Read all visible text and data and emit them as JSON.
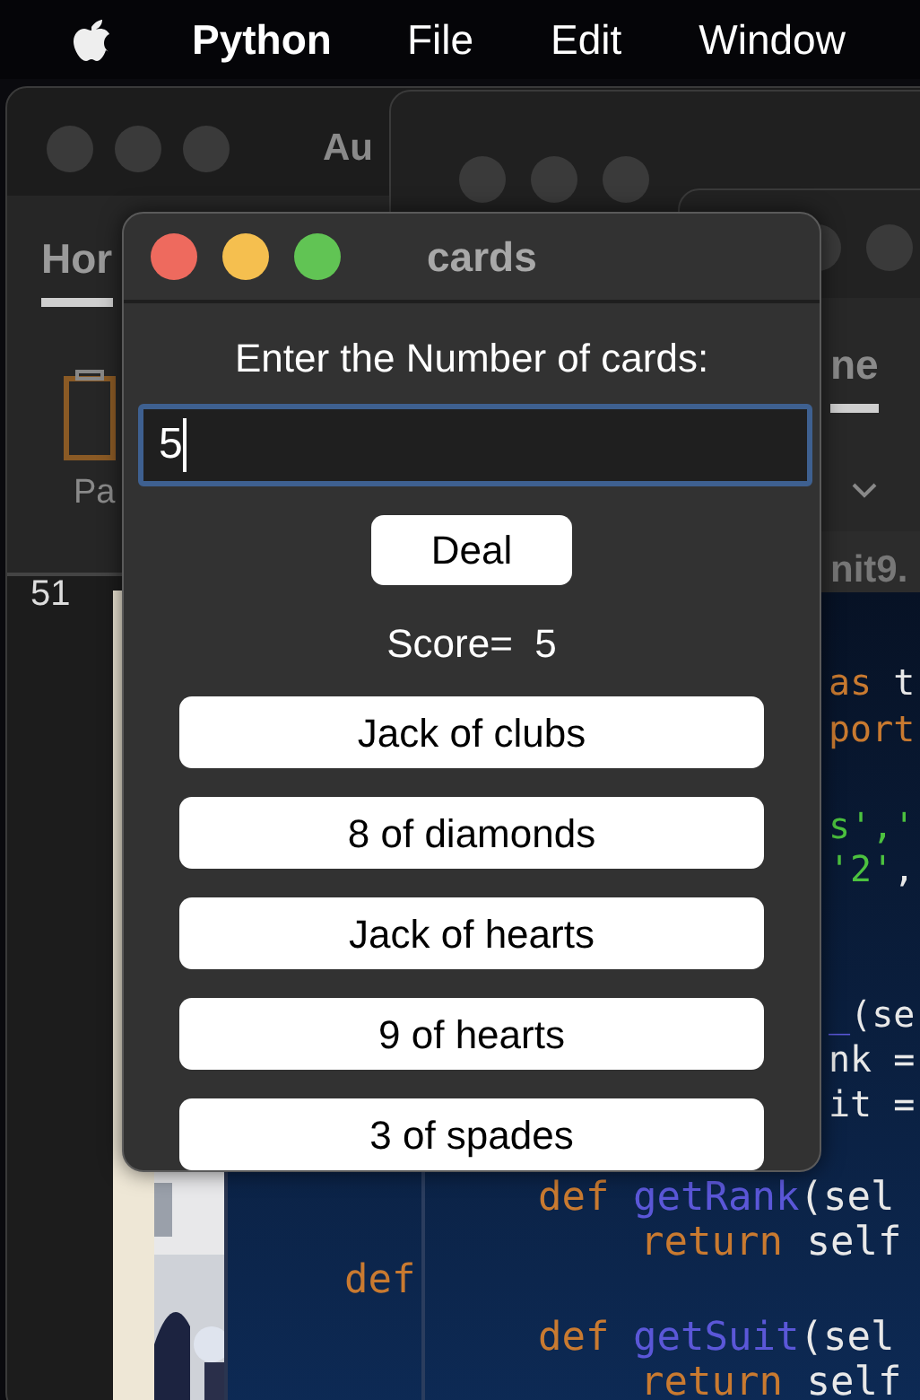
{
  "menu_bar": {
    "app": "Python",
    "items": [
      "File",
      "Edit",
      "Window"
    ]
  },
  "back_window_left": {
    "title": "Au",
    "ribbon_tab": "Hor",
    "paste_label": "Pa",
    "line_number": "51"
  },
  "back_window_right": {
    "ribbon_tab": "ne",
    "file_tab": "nit9.",
    "code_lines": [
      {
        "tokens": [
          {
            "kind": "keyword",
            "text": "as"
          },
          {
            "kind": "plain",
            "text": " t"
          }
        ]
      },
      {
        "tokens": [
          {
            "kind": "keyword",
            "text": "port"
          }
        ]
      },
      {
        "tokens": [
          {
            "kind": "string",
            "text": "s','"
          }
        ]
      },
      {
        "tokens": [
          {
            "kind": "string",
            "text": "'2'"
          },
          {
            "kind": "plain",
            "text": ","
          }
        ]
      },
      {
        "tokens": [
          {
            "kind": "function",
            "text": "_"
          },
          {
            "kind": "plain",
            "text": "(se"
          }
        ]
      },
      {
        "tokens": [
          {
            "kind": "plain",
            "text": "nk ="
          }
        ]
      },
      {
        "tokens": [
          {
            "kind": "plain",
            "text": "it ="
          }
        ]
      },
      {
        "tokens": [
          {
            "kind": "keyword",
            "text": "def"
          },
          {
            "kind": "function",
            "text": " getRank"
          },
          {
            "kind": "plain",
            "text": "(sel"
          }
        ]
      },
      {
        "tokens": [
          {
            "kind": "keyword",
            "text": "return"
          },
          {
            "kind": "plain",
            "text": " self"
          }
        ]
      },
      {
        "tokens": [
          {
            "kind": "keyword",
            "text": "def"
          }
        ]
      },
      {
        "tokens": [
          {
            "kind": "keyword",
            "text": "def"
          },
          {
            "kind": "function",
            "text": " getSuit"
          },
          {
            "kind": "plain",
            "text": "(sel"
          }
        ]
      },
      {
        "tokens": [
          {
            "kind": "keyword",
            "text": "return"
          },
          {
            "kind": "plain",
            "text": " self"
          }
        ]
      }
    ]
  },
  "dialog": {
    "title": "cards",
    "prompt": "Enter the Number of cards:",
    "input_value": "5",
    "deal_button": "Deal",
    "score": "Score=  5",
    "cards": [
      "Jack of clubs",
      "8 of diamonds",
      "Jack of hearts",
      "9 of hearts",
      "3 of spades"
    ]
  }
}
